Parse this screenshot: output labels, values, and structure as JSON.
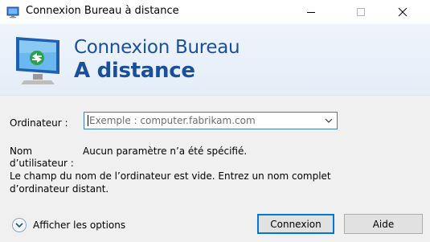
{
  "window": {
    "title": "Connexion Bureau à distance",
    "controls": [
      "minimize",
      "maximize",
      "close"
    ]
  },
  "banner": {
    "line1": "Connexion Bureau",
    "line2": "A distance"
  },
  "form": {
    "computer_label": "Ordinateur :",
    "computer_placeholder": "Exemple : computer.fabrikam.com",
    "username_label_1": "Nom",
    "username_label_2": "d’utilisateur :",
    "username_value": "Aucun paramètre n’a été spécifié.",
    "warning_line1": "Le champ du nom de l’ordinateur est vide. Entrez un nom complet",
    "warning_line2": "d’ordinateur distant."
  },
  "footer": {
    "options_label": "Afficher les options",
    "connect_label": "Connexion",
    "help_label": "Aide"
  },
  "colors": {
    "accent": "#1a4f9c",
    "focus_border": "#3c7fb1",
    "primary_button_border": "#0078d7"
  }
}
